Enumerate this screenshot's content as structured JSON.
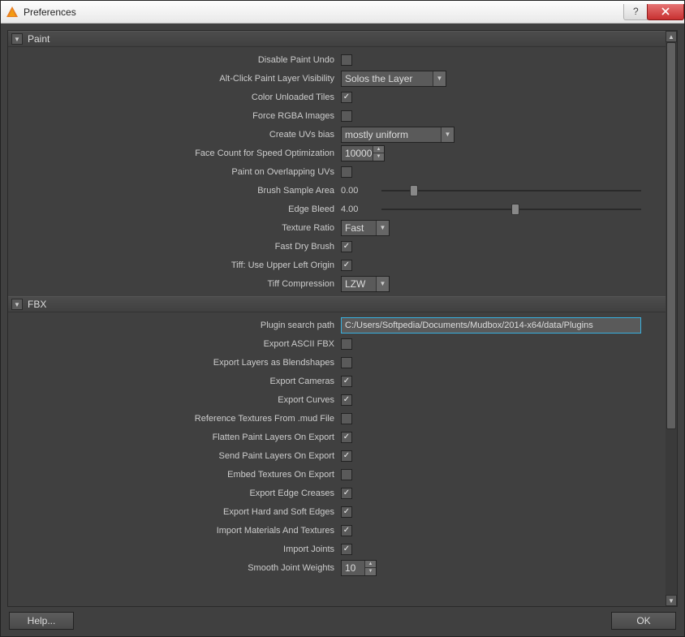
{
  "window": {
    "title": "Preferences"
  },
  "sections": {
    "paint": {
      "title": "Paint",
      "disable_paint_undo": {
        "label": "Disable Paint Undo",
        "checked": false
      },
      "alt_click_visibility": {
        "label": "Alt-Click Paint Layer Visibility",
        "value": "Solos the Layer"
      },
      "color_unloaded_tiles": {
        "label": "Color Unloaded Tiles",
        "checked": true
      },
      "force_rgba": {
        "label": "Force RGBA Images",
        "checked": false
      },
      "create_uvs_bias": {
        "label": "Create UVs bias",
        "value": "mostly uniform"
      },
      "face_count_speed": {
        "label": "Face Count for Speed Optimization",
        "value": "10000"
      },
      "paint_overlap_uvs": {
        "label": "Paint on Overlapping UVs",
        "checked": false
      },
      "brush_sample_area": {
        "label": "Brush Sample Area",
        "value": "0.00",
        "slider_pos": 0.11
      },
      "edge_bleed": {
        "label": "Edge Bleed",
        "value": "4.00",
        "slider_pos": 0.5
      },
      "texture_ratio": {
        "label": "Texture Ratio",
        "value": "Fast"
      },
      "fast_dry_brush": {
        "label": "Fast Dry Brush",
        "checked": true
      },
      "tiff_upper_left": {
        "label": "Tiff: Use Upper Left Origin",
        "checked": true
      },
      "tiff_compression": {
        "label": "Tiff Compression",
        "value": "LZW"
      }
    },
    "fbx": {
      "title": "FBX",
      "plugin_search_path": {
        "label": "Plugin search path",
        "value": "C:/Users/Softpedia/Documents/Mudbox/2014-x64/data/Plugins"
      },
      "export_ascii_fbx": {
        "label": "Export ASCII FBX",
        "checked": false
      },
      "export_layers_blend": {
        "label": "Export Layers as Blendshapes",
        "checked": false
      },
      "export_cameras": {
        "label": "Export Cameras",
        "checked": true
      },
      "export_curves": {
        "label": "Export Curves",
        "checked": true
      },
      "ref_textures_mud": {
        "label": "Reference Textures From .mud File",
        "checked": false
      },
      "flatten_paint_export": {
        "label": "Flatten Paint Layers On Export",
        "checked": true
      },
      "send_paint_export": {
        "label": "Send Paint Layers On Export",
        "checked": true
      },
      "embed_textures_export": {
        "label": "Embed Textures On Export",
        "checked": false
      },
      "export_edge_creases": {
        "label": "Export Edge Creases",
        "checked": true
      },
      "export_hard_soft": {
        "label": "Export Hard and Soft Edges",
        "checked": true
      },
      "import_materials": {
        "label": "Import Materials And Textures",
        "checked": true
      },
      "import_joints": {
        "label": "Import Joints",
        "checked": true
      },
      "smooth_joint_weights": {
        "label": "Smooth Joint Weights",
        "value": "10"
      }
    }
  },
  "footer": {
    "help": "Help...",
    "ok": "OK"
  }
}
